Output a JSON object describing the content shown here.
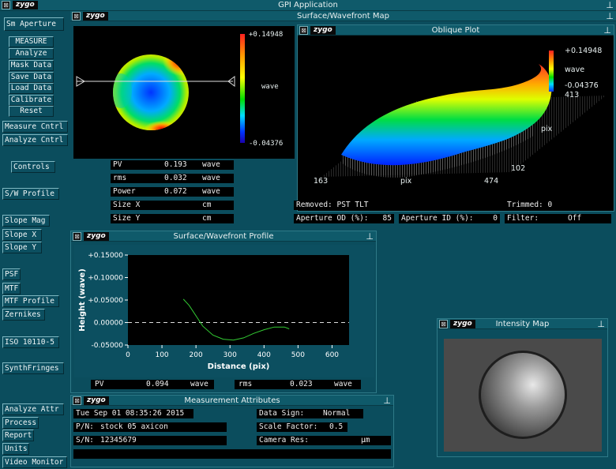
{
  "app_title": "GPI Application",
  "logo": "zygo",
  "colors": {
    "bg": "#0b4d5d",
    "colorbar": [
      "#ff2020",
      "#ff9900",
      "#ffff00",
      "#00dd00",
      "#00ddff",
      "#0033ff",
      "#1a00aa"
    ]
  },
  "sidebar": {
    "aperture": "Sm Aperture",
    "measure": "MEASURE",
    "analyze": "Analyze",
    "mask": "Mask Data",
    "save": "Save Data",
    "load": "Load Data",
    "calibrate": "Calibrate",
    "reset": "Reset",
    "measure_cntrl": "Measure Cntrl",
    "analyze_cntrl": "Analyze Cntrl",
    "controls": "Controls",
    "sw_profile": "S/W Profile",
    "slope_mag": "Slope Mag",
    "slope_x": "Slope X",
    "slope_y": "Slope Y",
    "psf": "PSF",
    "mtf": "MTF",
    "mtf_profile": "MTF Profile",
    "zernikes": "Zernikes",
    "iso": "ISO 10110-5",
    "synth": "SynthFringes",
    "analyze_attr": "Analyze Attr",
    "process": "Process",
    "report": "Report",
    "units": "Units",
    "video": "Video Monitor"
  },
  "surface_map": {
    "title": "Surface/Wavefront Map",
    "scale_max": "+0.14948",
    "scale_unit": "wave",
    "scale_min": "-0.04376",
    "results": [
      {
        "label": "PV",
        "value": "0.193",
        "unit": "wave"
      },
      {
        "label": "rms",
        "value": "0.032",
        "unit": "wave"
      },
      {
        "label": "Power",
        "value": "0.072",
        "unit": "wave"
      },
      {
        "label": "Size X",
        "value": "",
        "unit": "cm"
      },
      {
        "label": "Size Y",
        "value": "",
        "unit": "cm"
      }
    ],
    "removed": "Removed: PST TLT",
    "trimmed": "Trimmed:  0",
    "aperture_od_label": "Aperture OD (%):",
    "aperture_od_value": "85",
    "aperture_id_label": "Aperture ID (%):",
    "aperture_id_value": "0",
    "filter_label": "Filter:",
    "filter_value": "Off"
  },
  "oblique": {
    "title": "Oblique Plot",
    "scale_max": "+0.14948",
    "scale_unit": "wave",
    "scale_min": "-0.04376",
    "pix_value": "413",
    "x_min": "163",
    "x_label": "pix",
    "x_max": "474",
    "y_label": "pix",
    "y_min": "102"
  },
  "profile": {
    "title": "Surface/Wavefront Profile",
    "pv_label": "PV",
    "pv_value": "0.094",
    "pv_unit": "wave",
    "rms_label": "rms",
    "rms_value": "0.023",
    "rms_unit": "wave"
  },
  "chart_data": {
    "type": "line",
    "xlabel": "Distance (pix)",
    "ylabel": "Height (wave)",
    "xlim": [
      0,
      650
    ],
    "ylim": [
      -0.05,
      0.15
    ],
    "x_ticks": [
      "0",
      "100",
      "200",
      "300",
      "400",
      "500",
      "600"
    ],
    "y_ticks": [
      "+0.15000",
      "+0.10000",
      "+0.05000",
      "0.00000",
      "-0.05000"
    ],
    "series": [
      {
        "x": [
          163,
          180,
          200,
          220,
          250,
          280,
          310,
          340,
          370,
          400,
          430,
          460,
          474
        ],
        "y": [
          0.052,
          0.038,
          0.015,
          -0.008,
          -0.028,
          -0.037,
          -0.039,
          -0.034,
          -0.024,
          -0.016,
          -0.01,
          -0.01,
          -0.014
        ]
      }
    ],
    "reference_line": 0
  },
  "intensity": {
    "title": "Intensity Map"
  },
  "attributes": {
    "title": "Measurement Attributes",
    "date": "Tue Sep 01 08:35:26 2015",
    "pn_label": "P/N:",
    "pn_value": "stock 05 axicon",
    "sn_label": "S/N:",
    "sn_value": "12345679",
    "sign_label": "Data Sign:",
    "sign_value": "Normal",
    "scale_label": "Scale Factor:",
    "scale_value": "0.5",
    "camres_label": "Camera Res:",
    "camres_unit": "µm"
  }
}
